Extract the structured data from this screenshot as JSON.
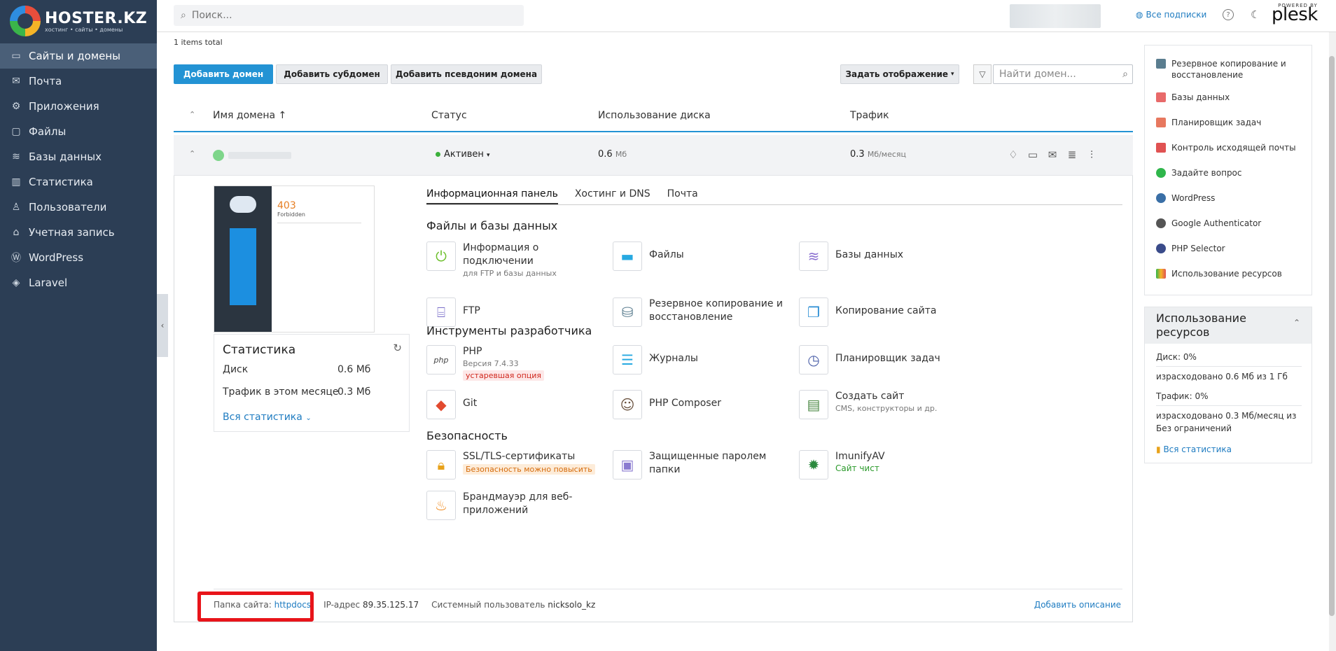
{
  "brand": {
    "title": "HOSTER.KZ",
    "subtitle": "хостинг • сайты • домены"
  },
  "sidebar": {
    "items": [
      {
        "label": "Сайты и домены",
        "icon": "monitor-icon",
        "active": true
      },
      {
        "label": "Почта",
        "icon": "mail-icon"
      },
      {
        "label": "Приложения",
        "icon": "gear-icon"
      },
      {
        "label": "Файлы",
        "icon": "folder-icon"
      },
      {
        "label": "Базы данных",
        "icon": "database-icon"
      },
      {
        "label": "Статистика",
        "icon": "chart-icon"
      },
      {
        "label": "Пользователи",
        "icon": "user-icon"
      },
      {
        "label": "Учетная запись",
        "icon": "account-icon"
      },
      {
        "label": "WordPress",
        "icon": "wordpress-icon"
      },
      {
        "label": "Laravel",
        "icon": "laravel-icon"
      }
    ]
  },
  "topbar": {
    "search_placeholder": "Поиск...",
    "subscriptions": "Все подписки",
    "powered_by": "POWERED BY",
    "plesk": "plesk"
  },
  "main": {
    "items_total": "1 items total",
    "buttons": {
      "add_domain": "Добавить домен",
      "add_subdomain": "Добавить субдомен",
      "add_alias": "Добавить псевдоним домена",
      "view": "Задать отображение"
    },
    "find_placeholder": "Найти домен...",
    "columns": {
      "domain": "Имя домена ↑",
      "status": "Статус",
      "disk": "Использование диска",
      "traffic": "Трафик"
    },
    "row": {
      "status": "Активен",
      "disk_value": "0.6",
      "disk_unit": "Мб",
      "traffic_value": "0.3",
      "traffic_unit": "Мб/месяц"
    }
  },
  "preview": {
    "code": "403",
    "text": "Forbidden"
  },
  "stats": {
    "title": "Статистика",
    "disk_label": "Диск",
    "disk_value": "0.6 Мб",
    "traffic_label": "Трафик в этом месяце",
    "traffic_value": "0.3 Мб",
    "all": "Вся статистика"
  },
  "tabs": [
    "Информационная панель",
    "Хостинг и DNS",
    "Почта"
  ],
  "sections": {
    "files": "Файлы и базы данных",
    "dev": "Инструменты разработчика",
    "security": "Безопасность"
  },
  "tools": {
    "conn_l1": "Информация о",
    "conn_l2": "подключении",
    "conn_sub": "для FTP и базы данных",
    "files": "Файлы",
    "db": "Базы данных",
    "ftp": "FTP",
    "backup_l1": "Резервное копирование и",
    "backup_l2": "восстановление",
    "copy": "Копирование сайта",
    "php": "PHP",
    "php_ver": "Версия 7.4.33",
    "php_tag": "устаревшая опция",
    "logs": "Журналы",
    "scheduler": "Планировщик задач",
    "git": "Git",
    "composer": "PHP Composer",
    "create": "Создать сайт",
    "create_sub": "CMS, конструкторы и др.",
    "ssl": "SSL/TLS-сертификаты",
    "ssl_tag": "Безопасность можно повысить",
    "protected_l1": "Защищенные паролем",
    "protected_l2": "папки",
    "imunify": "ImunifyAV",
    "imunify_tag": "Сайт чист",
    "waf_l1": "Брандмауэр для веб-",
    "waf_l2": "приложений"
  },
  "footer": {
    "folder_label": "Папка сайта:",
    "folder_value": "httpdocs",
    "ip_label": "IP-адрес",
    "ip_value": "89.35.125.17",
    "user_label": "Системный пользователь",
    "user_value": "nicksolo_kz",
    "add_desc": "Добавить описание"
  },
  "right_panel": {
    "items": [
      "Резервное копирование и восстановление",
      "Базы данных",
      "Планировщик задач",
      "Контроль исходящей почты",
      "Задайте вопрос",
      "WordPress",
      "Google Authenticator",
      "PHP Selector",
      "Использование ресурсов"
    ]
  },
  "resources": {
    "title": "Использование ресурсов",
    "disk": "Диск: 0%",
    "disk_detail": "израсходовано 0.6 Мб из 1 Гб",
    "traffic": "Трафик: 0%",
    "traffic_detail_l1": "израсходовано 0.3 Мб/месяц из",
    "traffic_detail_l2": "Без ограничений",
    "all": "Вся статистика"
  }
}
